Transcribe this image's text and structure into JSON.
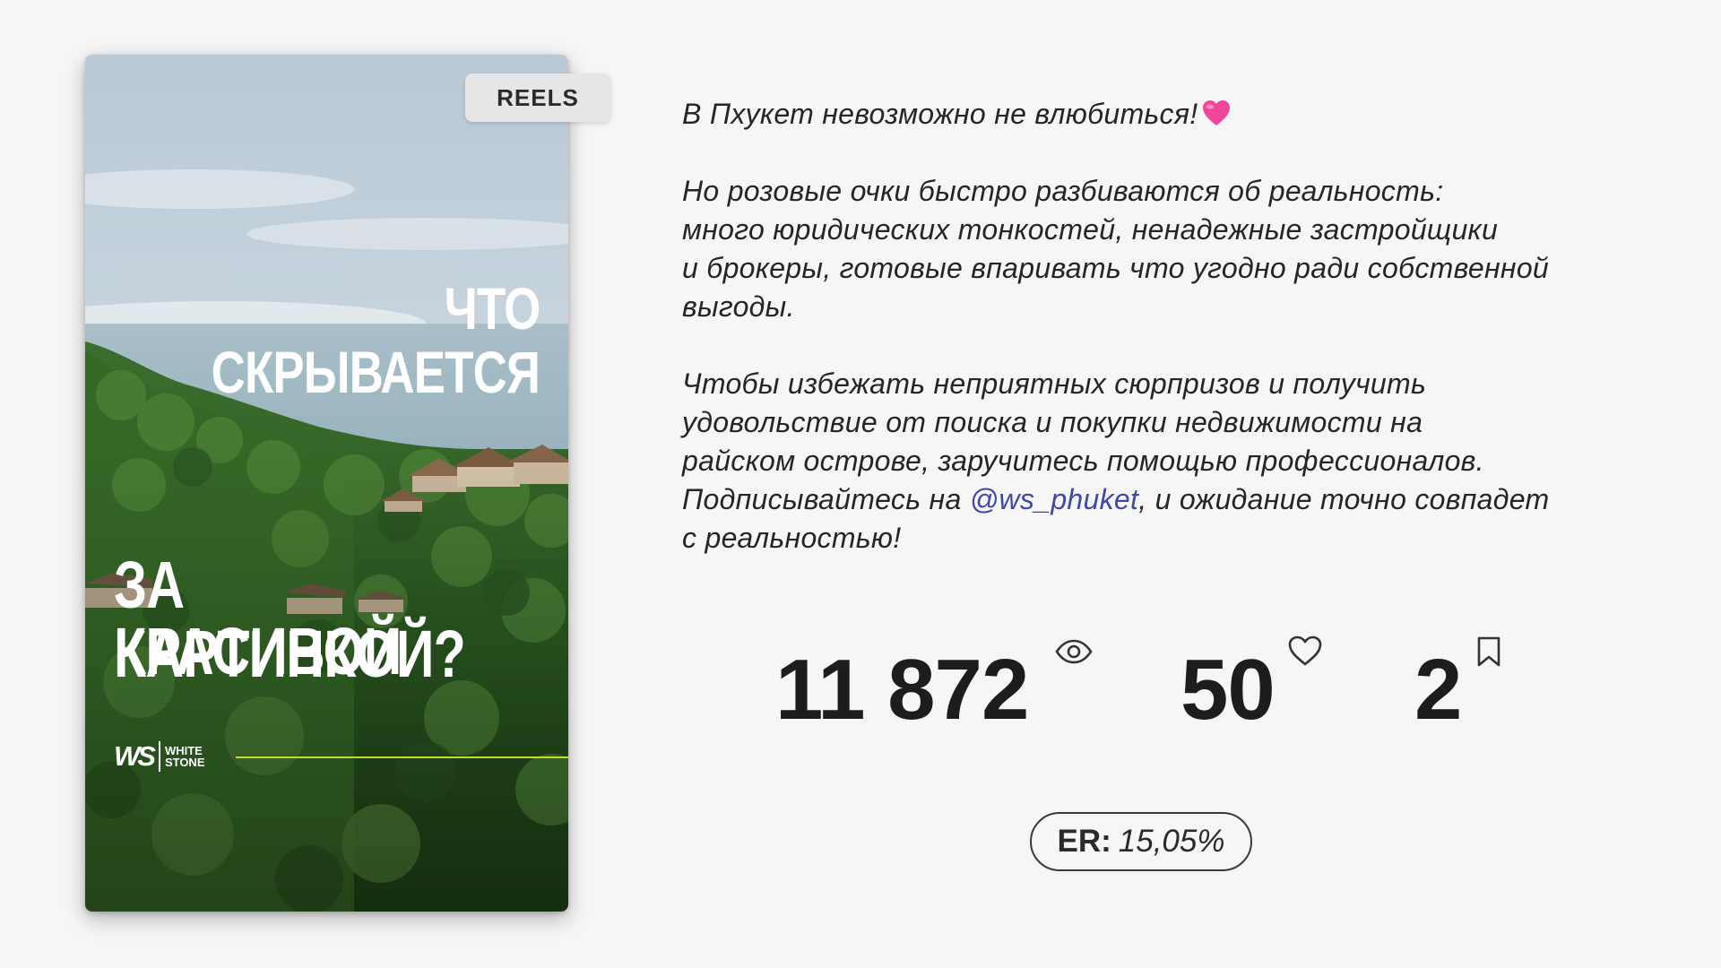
{
  "reel": {
    "badge": "REELS",
    "title_lines": [
      "ЧТО",
      "СКРЫВАЕТСЯ",
      "ЗА КРАСИВОЙ",
      "КАРТИНКОЙ?"
    ],
    "brand": {
      "mark": "WS",
      "name_line1": "WHITE",
      "name_line2": "STONE"
    },
    "accent_line_color": "#c4dc2a"
  },
  "caption": {
    "p1": "В Пхукет невозможно не влюбиться!",
    "p1_emoji": "pink-heart-emoji",
    "p2": [
      "Но розовые очки быстро разбиваются об реальность:",
      "много юридических тонкостей, ненадежные застройщики",
      "и брокеры, готовые впаривать что угодно ради собственной",
      "выгоды."
    ],
    "p3": [
      "Чтобы избежать неприятных сюрпризов и получить",
      "удовольствие от поиска и покупки недвижимости на",
      "райском острове, заручитесь помощью профессионалов."
    ],
    "p3_mention_before": "Подписывайтесь на ",
    "p3_mention": "@ws_phuket",
    "p3_mention_after": ", и ожидание точно совпадет",
    "p3_last": "с реальностью!",
    "mention_color": "#3f48a8"
  },
  "stats": {
    "views": "11 872",
    "views_icon": "eye-icon",
    "likes": "50",
    "likes_icon": "heart-icon",
    "saves": "2",
    "saves_icon": "bookmark-icon"
  },
  "er": {
    "label": "ER:",
    "value": "15,05%"
  }
}
